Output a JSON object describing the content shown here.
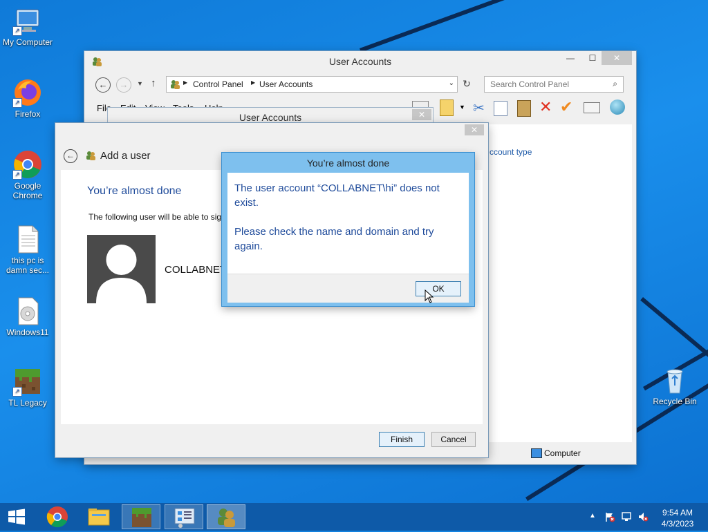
{
  "desktop": {
    "icons": [
      {
        "label": "My Computer"
      },
      {
        "label": "Firefox"
      },
      {
        "label": "Google Chrome"
      },
      {
        "label": "this pc is damn sec..."
      },
      {
        "label": "Windows11"
      },
      {
        "label": "TL Legacy"
      },
      {
        "label": "Recycle Bin"
      }
    ]
  },
  "control_panel": {
    "title": "User Accounts",
    "breadcrumb": [
      "Control Panel",
      "User Accounts"
    ],
    "search_placeholder": "Search Control Panel",
    "menu": [
      "File",
      "Edit",
      "View",
      "Tools",
      "Help"
    ],
    "link_partial": "ccount type",
    "status_computer": "Computer"
  },
  "user_accounts_dialog": {
    "title": "User Accounts"
  },
  "add_user_wizard": {
    "header": "Add a user",
    "heading": "You’re almost done",
    "body_text": "The following user will be able to sig",
    "user_name_partial": "COLLABNET",
    "finish_label": "Finish",
    "cancel_label": "Cancel"
  },
  "error_dialog": {
    "title": "You’re almost done",
    "line1": "The user account “COLLABNET\\hi” does not exist.",
    "line2": "Please check the name and domain and try again.",
    "ok_label": "OK"
  },
  "taskbar": {
    "time": "9:54 AM",
    "date": "4/3/2023"
  },
  "colors": {
    "accent_blue": "#1e5aa8",
    "dialog_frame": "#7ec0ee",
    "taskbar": "#0e5aa8"
  }
}
